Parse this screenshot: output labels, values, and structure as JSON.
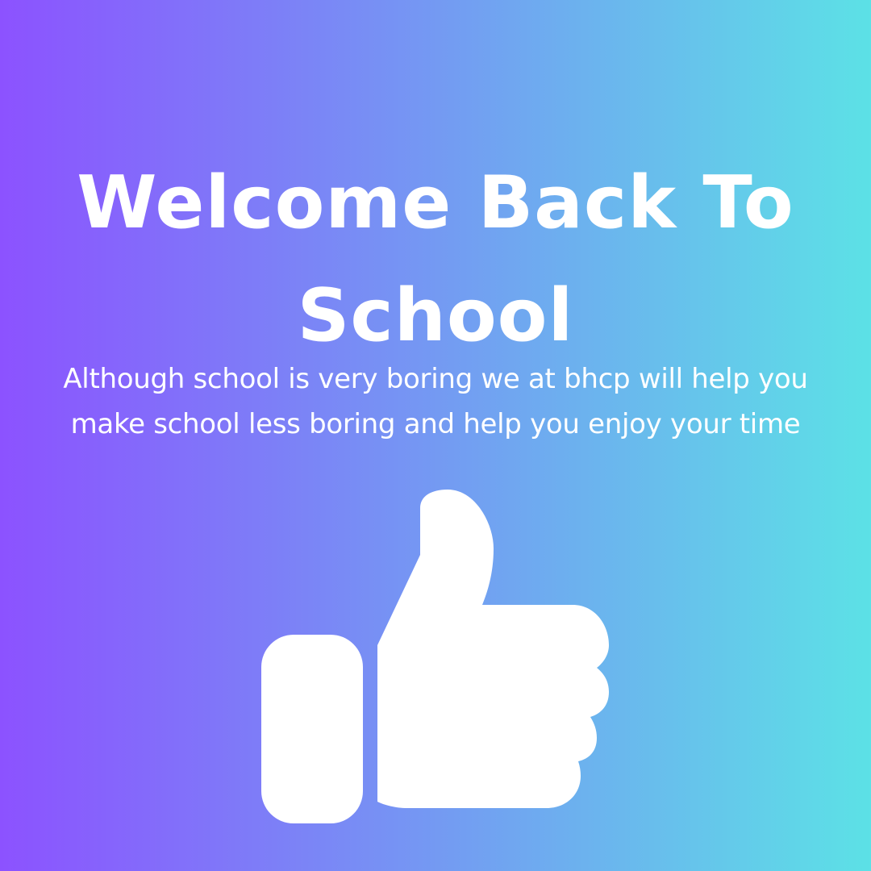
{
  "background": {
    "gradient_start": "#8c52ff",
    "gradient_end": "#5ce1e6"
  },
  "headline": {
    "line1": "Welcome Back To",
    "line2": "School"
  },
  "message": {
    "line1": "Although school is very boring we at bhcp will help you",
    "line2": "make school less boring and help you enjoy your time"
  },
  "graphic": {
    "icon": "thumbs-up-icon",
    "color": "#ffffff"
  }
}
